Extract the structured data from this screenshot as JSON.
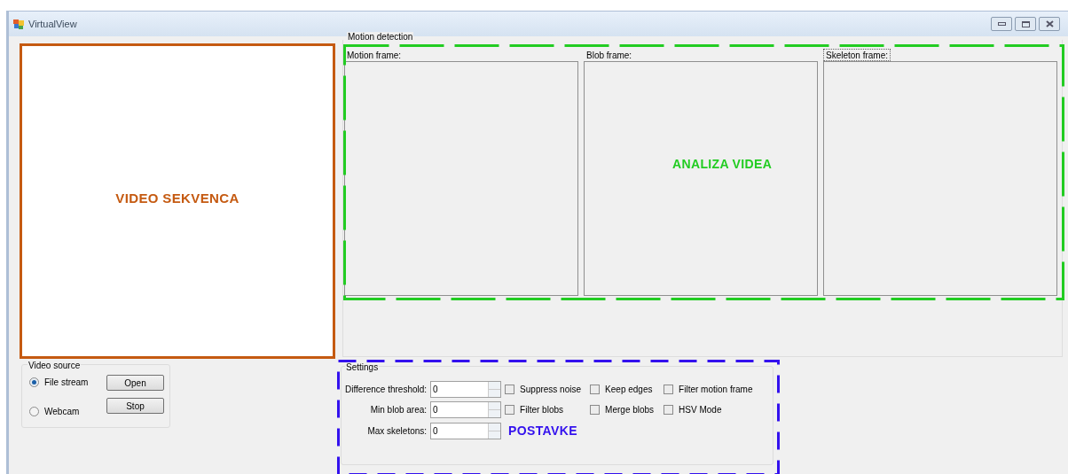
{
  "window": {
    "title": "VirtualView"
  },
  "video_panel": {
    "label": "VIDEO SEKVENCA"
  },
  "motion_detection": {
    "title": "Motion detection",
    "annotation": "ANALIZA VIDEA",
    "frames": [
      {
        "label": "Motion frame:",
        "focused": false
      },
      {
        "label": "Blob frame:",
        "focused": false
      },
      {
        "label": "Skeleton frame:",
        "focused": true
      }
    ]
  },
  "video_source": {
    "title": "Video source",
    "options": [
      {
        "label": "File stream",
        "selected": true
      },
      {
        "label": "Webcam",
        "selected": false
      }
    ],
    "buttons": [
      "Open",
      "Stop"
    ]
  },
  "settings": {
    "title": "Settings",
    "annotation": "POSTAVKE",
    "fields": [
      {
        "label": "Difference threshold:",
        "value": "0"
      },
      {
        "label": "Min blob area:",
        "value": "0"
      },
      {
        "label": "Max skeletons:",
        "value": "0"
      }
    ],
    "checkboxes": [
      {
        "label": "Suppress noise",
        "checked": false
      },
      {
        "label": "Keep edges",
        "checked": false
      },
      {
        "label": "Filter motion frame",
        "checked": false
      },
      {
        "label": "Filter blobs",
        "checked": false
      },
      {
        "label": "Merge blobs",
        "checked": false
      },
      {
        "label": "HSV Mode",
        "checked": false
      }
    ]
  }
}
